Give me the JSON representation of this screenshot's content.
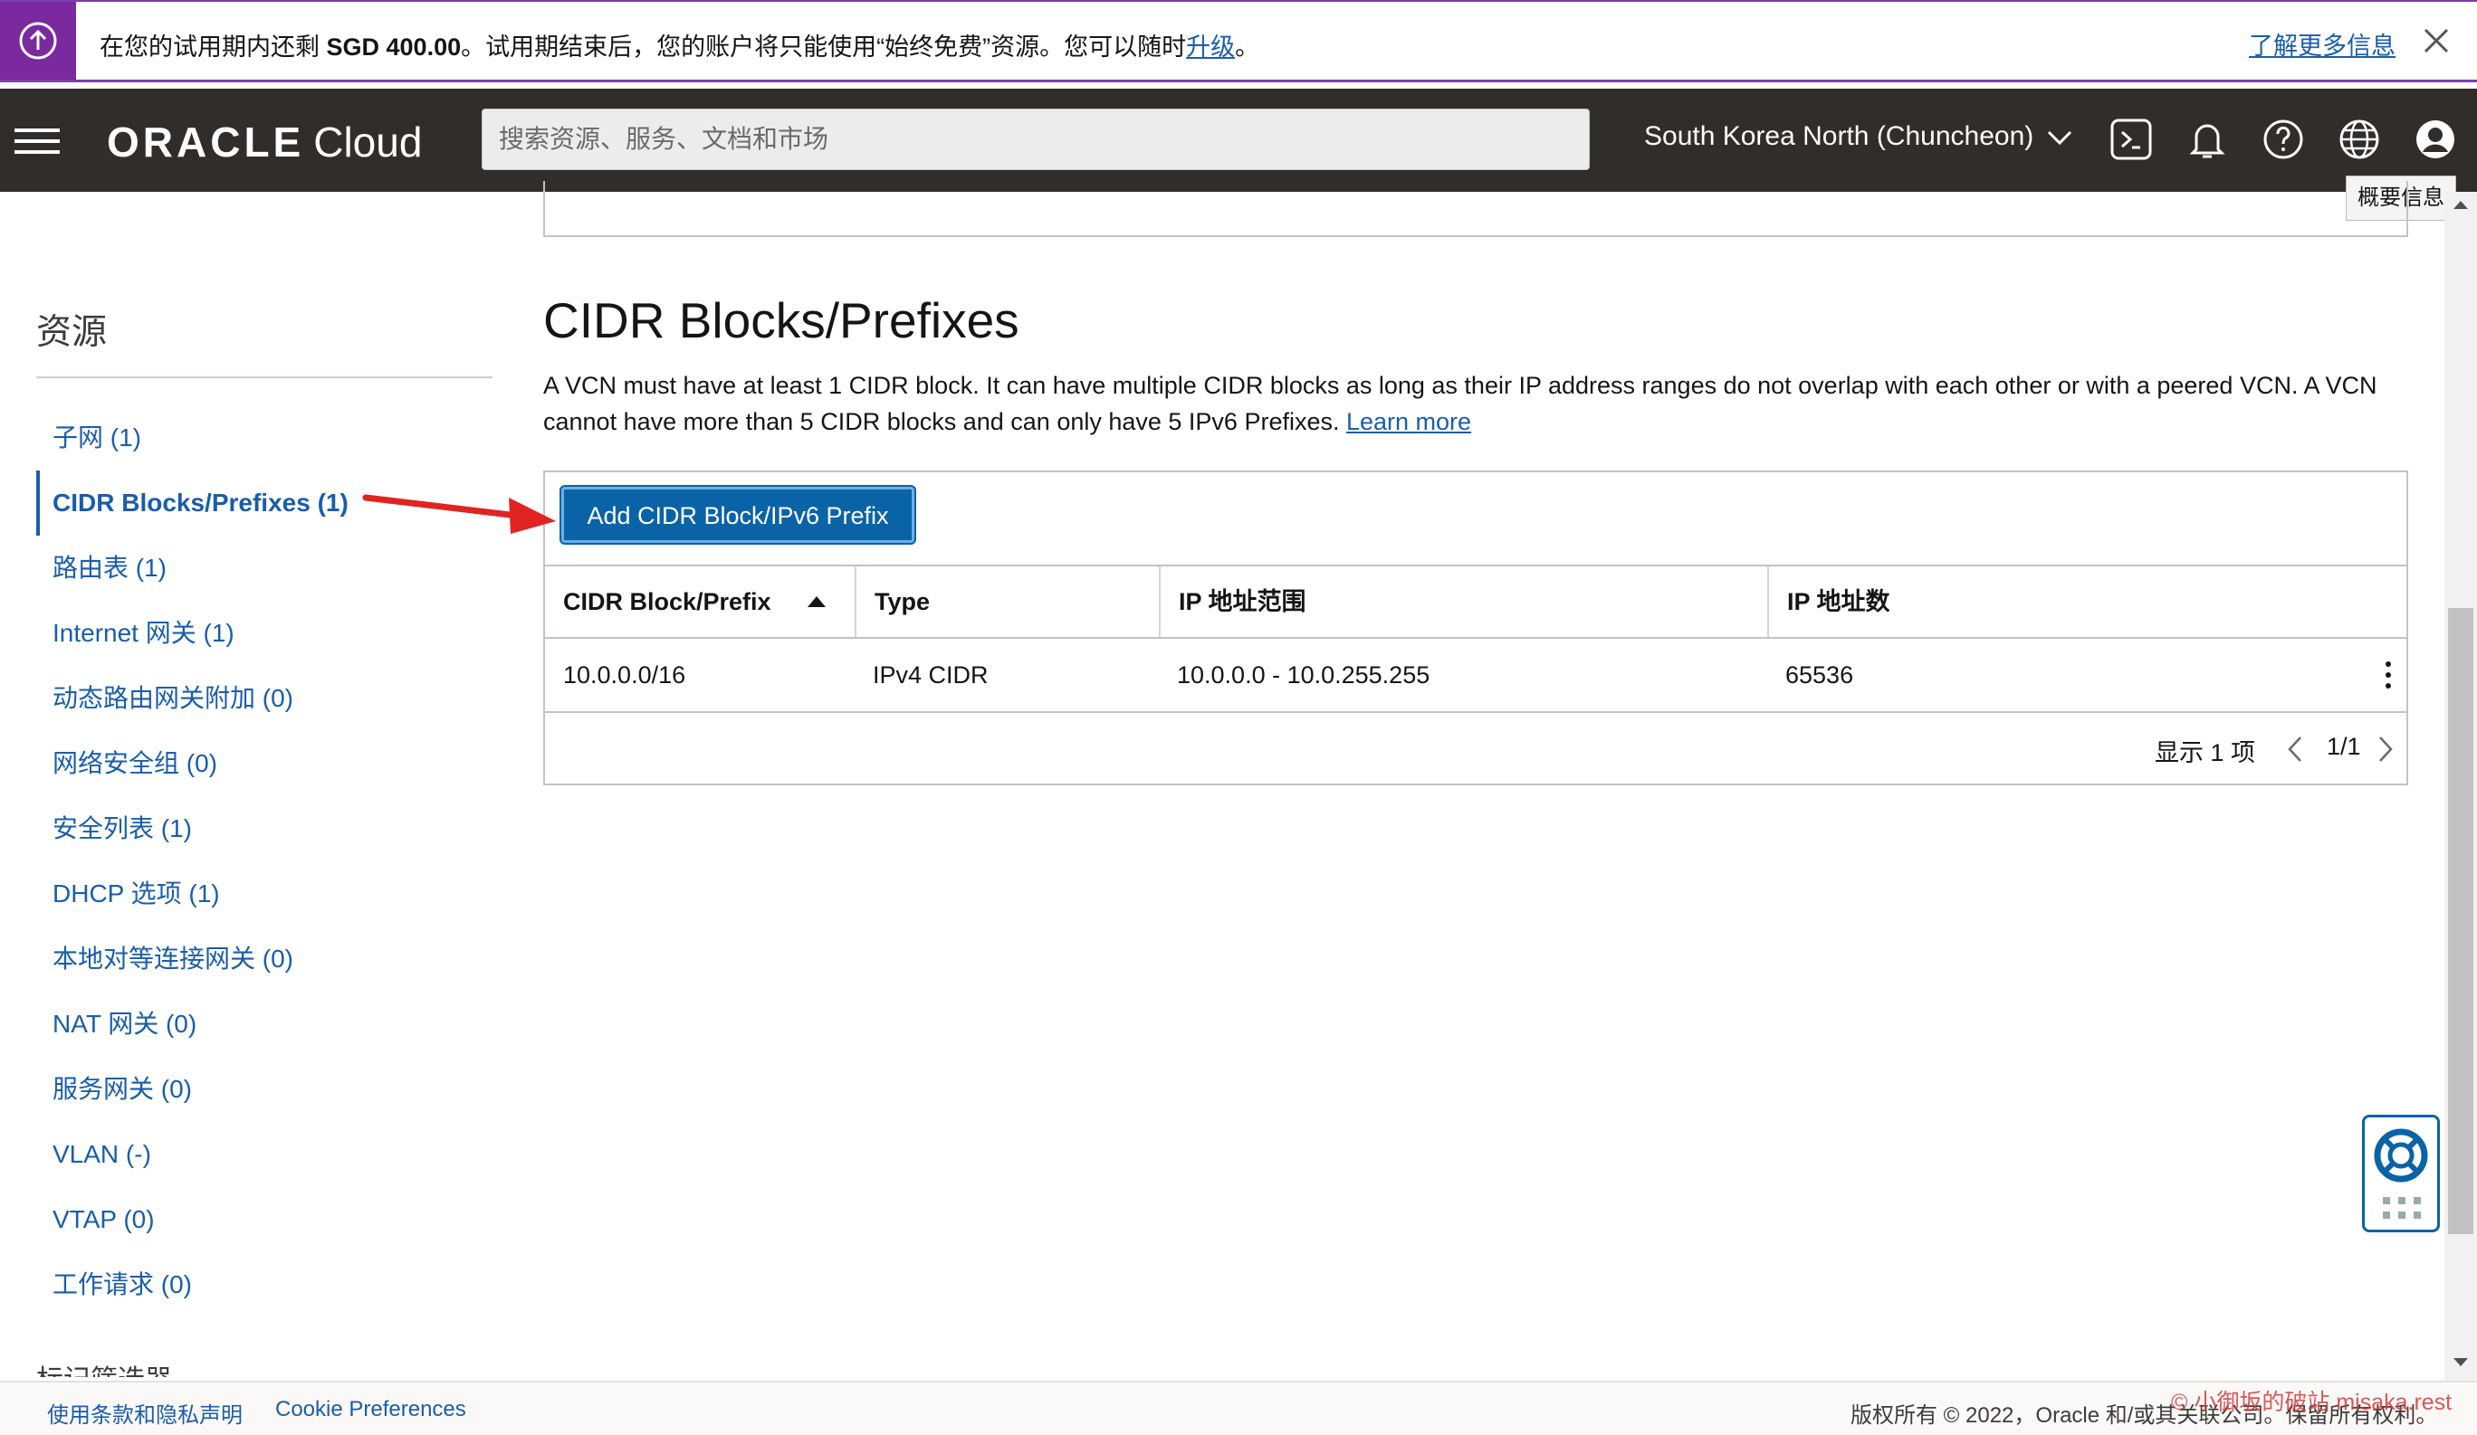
{
  "banner": {
    "text_before": "在您的试用期内还剩 ",
    "amount": "SGD 400.00",
    "text_after": "。试用期结束后，您的账户将只能使用“始终免费”资源。您可以随时",
    "upgrade_link": "升级",
    "text_end": "。",
    "learn_more": "了解更多信息"
  },
  "header": {
    "logo_brand": "ORACLE",
    "logo_product": "Cloud",
    "search_placeholder": "搜索资源、服务、文档和市场",
    "region": "South Korea North (Chuncheon)",
    "profile_tooltip": "概要信息"
  },
  "sidebar": {
    "title": "资源",
    "items": [
      {
        "label": "子网 (1)",
        "active": false
      },
      {
        "label": "CIDR Blocks/Prefixes (1)",
        "active": true
      },
      {
        "label": "路由表 (1)",
        "active": false
      },
      {
        "label": "Internet 网关 (1)",
        "active": false
      },
      {
        "label": "动态路由网关附加 (0)",
        "active": false
      },
      {
        "label": "网络安全组 (0)",
        "active": false
      },
      {
        "label": "安全列表 (1)",
        "active": false
      },
      {
        "label": "DHCP 选项 (1)",
        "active": false
      },
      {
        "label": "本地对等连接网关 (0)",
        "active": false
      },
      {
        "label": "NAT 网关 (0)",
        "active": false
      },
      {
        "label": "服务网关 (0)",
        "active": false
      },
      {
        "label": "VLAN (-)",
        "active": false
      },
      {
        "label": "VTAP (0)",
        "active": false
      },
      {
        "label": "工作请求 (0)",
        "active": false
      }
    ],
    "cut_off_heading": "标记筛选器"
  },
  "main": {
    "title": "CIDR Blocks/Prefixes",
    "description": "A VCN must have at least 1 CIDR block. It can have multiple CIDR blocks as long as their IP address ranges do not overlap with each other or with a peered VCN. A VCN cannot have more than 5 CIDR blocks and can only have 5 IPv6 Prefixes. ",
    "learn_more": "Learn more",
    "add_button": "Add CIDR Block/IPv6 Prefix",
    "columns": [
      "CIDR Block/Prefix",
      "Type",
      "IP 地址范围",
      "IP 地址数"
    ],
    "rows": [
      {
        "cidr": "10.0.0.0/16",
        "type": "IPv4 CIDR",
        "range": "10.0.0.0 - 10.0.255.255",
        "count": "65536"
      }
    ],
    "pager": {
      "showing": "显示 1 项",
      "page": "1/1"
    }
  },
  "footer": {
    "terms": "使用条款和隐私声明",
    "cookies": "Cookie Preferences",
    "copyright": "版权所有 © 2022，Oracle 和/或其关联公司。保留所有权利。",
    "watermark": "© 小御坂的破站 misaka.rest"
  },
  "colors": {
    "header_bg": "#312d2a",
    "banner_accent": "#7a2a9e",
    "link": "#1a5dab",
    "primary_button": "#0a63a6",
    "annotation_arrow": "#e02424"
  },
  "icons": [
    "upload-circle-icon",
    "close-icon",
    "hamburger-menu-icon",
    "chevron-down-icon",
    "cloud-shell-icon",
    "bell-icon",
    "help-icon",
    "globe-icon",
    "profile-icon",
    "sort-ascending-icon",
    "kebab-menu-icon",
    "chevron-left-icon",
    "chevron-right-icon",
    "lifebuoy-icon",
    "apps-grid-icon"
  ]
}
